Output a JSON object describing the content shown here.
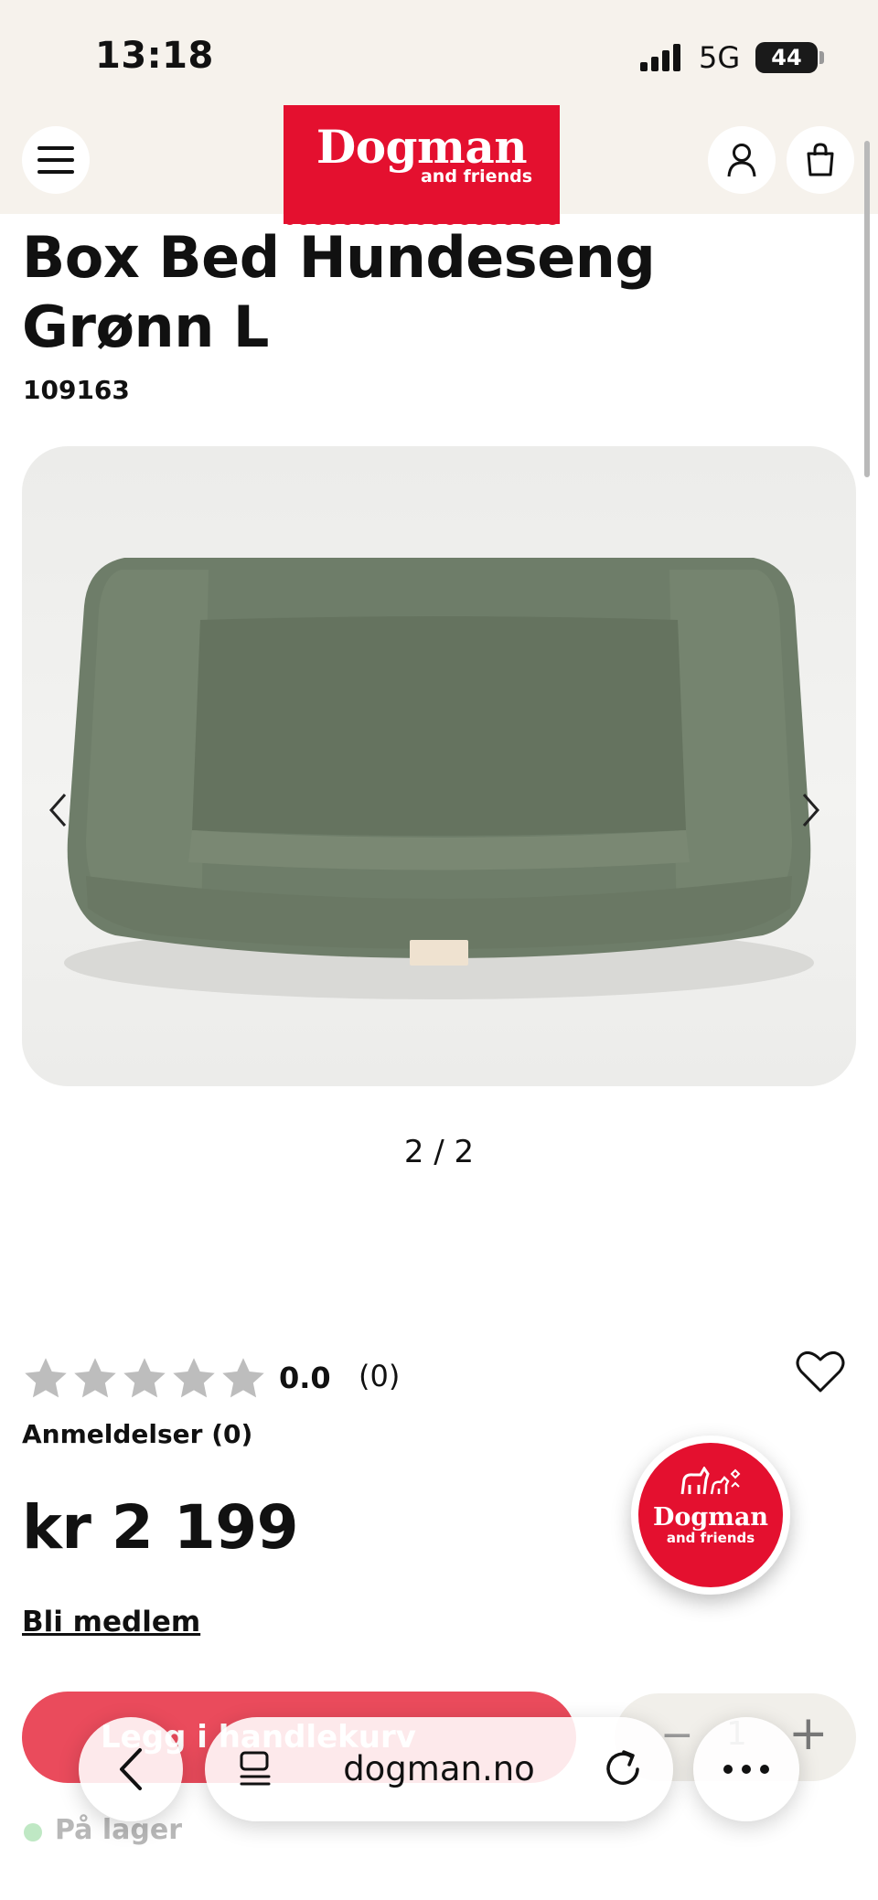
{
  "status_bar": {
    "time": "13:18",
    "network": "5G",
    "battery": "44"
  },
  "header": {
    "logo_main": "Dogman",
    "logo_sub": "and friends",
    "brand_color": "#e4102f",
    "icons": [
      "menu-icon",
      "user-icon",
      "bag-icon"
    ]
  },
  "product": {
    "title": "Box Bed Hundeseng Grønn L",
    "sku": "109163",
    "image_counter": "2 / 2",
    "rating": "0.0",
    "rating_count": "(0)",
    "rating_stars": 0,
    "reviews_link": "Anmeldelser (0)",
    "price": "kr 2 199",
    "member_link": "Bli medlem",
    "stock": "På lager"
  },
  "cart": {
    "add_button": "Legg i handlekurv",
    "accent_color": "#ea4b5c",
    "minus": "−",
    "quantity": "1",
    "plus": "+"
  },
  "fab": {
    "main": "Dogman",
    "sub": "and friends"
  },
  "browser": {
    "url": "dogman.no"
  }
}
